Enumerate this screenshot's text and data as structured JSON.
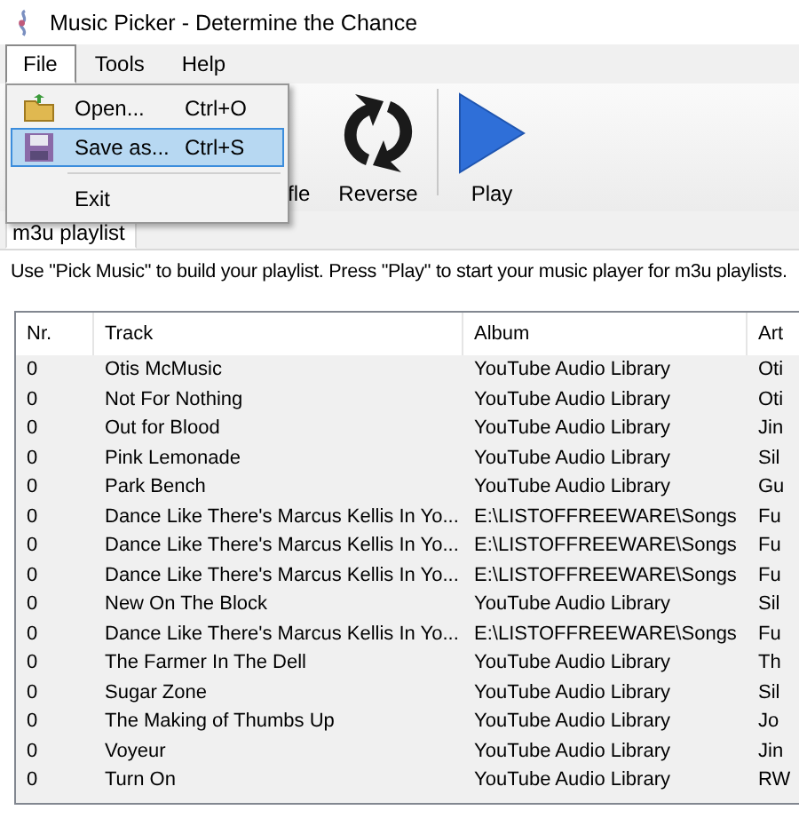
{
  "window": {
    "title": "Music Picker - Determine the Chance"
  },
  "menubar": [
    {
      "label": "File",
      "selected": true
    },
    {
      "label": "Tools",
      "selected": false
    },
    {
      "label": "Help",
      "selected": false
    }
  ],
  "file_menu": [
    {
      "kind": "item",
      "label": "Open...",
      "shortcut": "Ctrl+O",
      "selected": false
    },
    {
      "kind": "item",
      "label": "Save as...",
      "shortcut": "Ctrl+S",
      "selected": true
    },
    {
      "kind": "separator"
    },
    {
      "kind": "item",
      "label": "Exit",
      "selected": false
    }
  ],
  "toolbar": [
    {
      "kind": "partial",
      "label": "fle"
    },
    {
      "kind": "reverse",
      "label": "Reverse"
    },
    {
      "kind": "separator"
    },
    {
      "kind": "play",
      "label": "Play"
    }
  ],
  "tabs": [
    {
      "label": "m3u playlist",
      "selected": true
    }
  ],
  "instructions": "Use \"Pick Music\" to build your playlist. Press \"Play\" to start your music player for m3u playlists.",
  "table": {
    "columns": [
      "Nr.",
      "Track",
      "Album",
      "Art"
    ],
    "rows": [
      [
        "0",
        "Otis McMusic",
        "YouTube Audio Library",
        "Oti"
      ],
      [
        "0",
        "Not For Nothing",
        "YouTube Audio Library",
        "Oti"
      ],
      [
        "0",
        "Out for Blood",
        "YouTube Audio Library",
        "Jin"
      ],
      [
        "0",
        "Pink Lemonade",
        "YouTube Audio Library",
        "Sil"
      ],
      [
        "0",
        "Park Bench",
        "YouTube Audio Library",
        "Gu"
      ],
      [
        "0",
        "Dance Like There's Marcus Kellis In Yo...",
        "E:\\LISTOFFREEWARE\\Songs",
        "Fu"
      ],
      [
        "0",
        "Dance Like There's Marcus Kellis In Yo...",
        "E:\\LISTOFFREEWARE\\Songs",
        "Fu"
      ],
      [
        "0",
        "Dance Like There's Marcus Kellis In Yo...",
        "E:\\LISTOFFREEWARE\\Songs",
        "Fu"
      ],
      [
        "0",
        "New On The Block",
        "YouTube Audio Library",
        "Sil"
      ],
      [
        "0",
        "Dance Like There's Marcus Kellis In Yo...",
        "E:\\LISTOFFREEWARE\\Songs",
        "Fu"
      ],
      [
        "0",
        "The Farmer In The Dell",
        "YouTube Audio Library",
        "Th"
      ],
      [
        "0",
        "Sugar Zone",
        "YouTube Audio Library",
        "Sil"
      ],
      [
        "0",
        "The Making of Thumbs Up",
        "YouTube Audio Library",
        "Jo"
      ],
      [
        "0",
        "Voyeur",
        "YouTube Audio Library",
        "Jin"
      ],
      [
        "0",
        "Turn On",
        "YouTube Audio Library",
        "RW"
      ]
    ]
  }
}
